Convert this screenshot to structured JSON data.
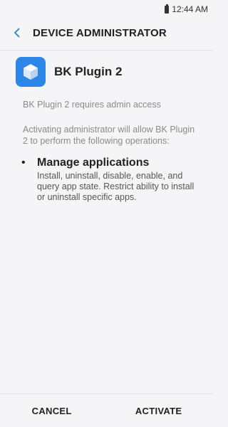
{
  "status_bar": {
    "time": "12:44 AM"
  },
  "app_bar": {
    "title": "DEVICE ADMINISTRATOR"
  },
  "app": {
    "name": "BK Plugin 2",
    "icon": "cube-icon",
    "icon_color": "#2e86e8"
  },
  "admin_access_text": "BK Plugin 2 requires admin access",
  "activating_text": "Activating administrator will allow BK Plugin 2 to perform the following operations:",
  "permissions": [
    {
      "title": "Manage applications",
      "description": "Install, uninstall, disable, enable, and query app state. Restrict ability to install or uninstall specific apps."
    }
  ],
  "buttons": {
    "cancel": "CANCEL",
    "activate": "ACTIVATE"
  }
}
